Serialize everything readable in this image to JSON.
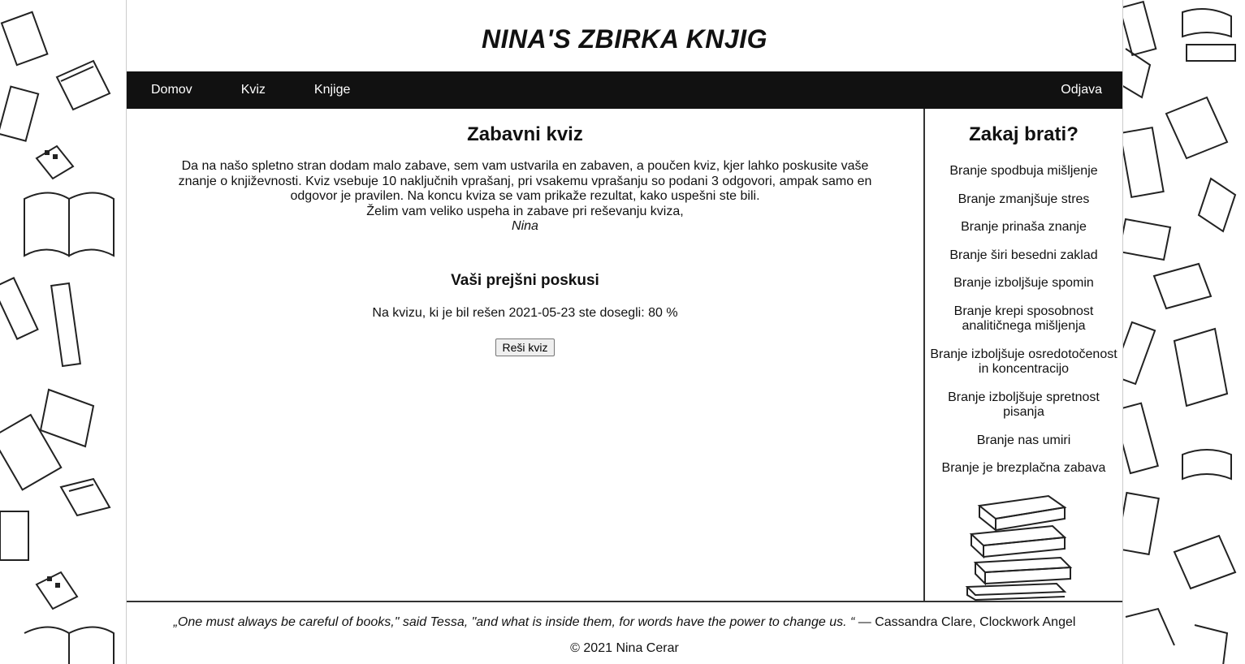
{
  "site": {
    "title": "NINA'S ZBIRKA KNJIG"
  },
  "nav": {
    "home": "Domov",
    "quiz": "Kviz",
    "books": "Knjige",
    "logout": "Odjava"
  },
  "main": {
    "heading": "Zabavni kviz",
    "intro": "Da na našo spletno stran dodam malo zabave, sem vam ustvarila en zabaven, a poučen kviz, kjer lahko poskusite vaše znanje o književnosti. Kviz vsebuje 10 naključnih vprašanj, pri vsakemu vprašanju so podani 3 odgovori, ampak samo en odgovor je pravilen. Na koncu kviza se vam prikaže rezultat, kako uspešni ste bili.",
    "wish": "Želim vam veliko uspeha in zabave pri reševanju kviza,",
    "signature": "Nina",
    "attempts_heading": "Vaši prejšni poskusi",
    "attempt_text": "Na kvizu, ki je bil rešen 2021-05-23 ste dosegli: 80 %",
    "quiz_button": "Reši kviz"
  },
  "aside": {
    "heading": "Zakaj brati?",
    "reasons": [
      "Branje spodbuja mišljenje",
      "Branje zmanjšuje stres",
      "Branje prinaša znanje",
      "Branje širi besedni zaklad",
      "Branje izboljšuje spomin",
      "Branje krepi sposobnost analitičnega mišljenja",
      "Branje izboljšuje osredotočenost in koncentracijo",
      "Branje izboljšuje spretnost pisanja",
      "Branje nas umiri",
      "Branje je brezplačna zabava"
    ]
  },
  "footer": {
    "quote": "„One must always be careful of books,\" said Tessa, \"and what is inside them, for words have the power to change us. “",
    "attribution": " — Cassandra Clare, Clockwork Angel",
    "copyright": "© 2021 Nina Cerar"
  },
  "colors": {
    "nav_bg": "#111111",
    "nav_text": "#ffffff",
    "page_bg": "#ffffff"
  }
}
